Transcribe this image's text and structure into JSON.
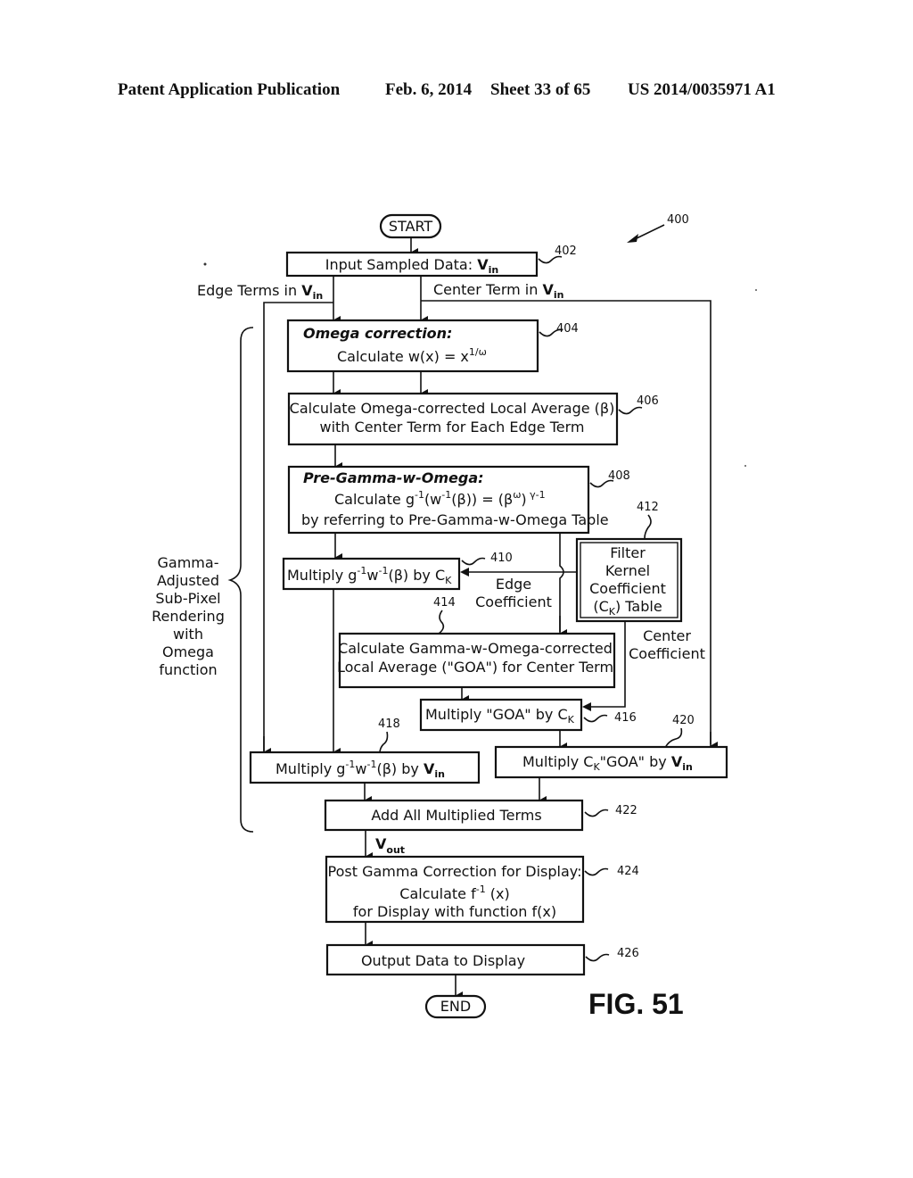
{
  "header": {
    "publication": "Patent Application Publication",
    "date": "Feb. 6, 2014",
    "sheet": "Sheet 33 of 65",
    "number": "US 2014/0035971 A1"
  },
  "figure": {
    "label": "FIG. 51",
    "ref": "400",
    "start": "START",
    "end": "END",
    "bracket_label": [
      "Gamma-",
      "Adjusted",
      "Sub-Pixel",
      "Rendering",
      "with",
      "Omega",
      "function"
    ],
    "edge_terms_label": "Edge Terms in ",
    "center_term_label": "Center Term in ",
    "vin_main": "V",
    "vin_sub": "in",
    "vout_main": "V",
    "vout_sub": "out",
    "edge_coefficient": [
      "Edge",
      "Coefficient"
    ],
    "center_coefficient": [
      "Center",
      "Coefficient"
    ],
    "steps": {
      "s402": {
        "ref": "402",
        "text": "Input Sampled Data: "
      },
      "s404": {
        "ref": "404",
        "title": "Omega correction:",
        "line": "Calculate w(x) = x",
        "sup": "1/ω"
      },
      "s406": {
        "ref": "406",
        "lines": [
          "Calculate Omega-corrected Local Average (β)",
          "with Center Term for Each Edge Term"
        ]
      },
      "s408": {
        "ref": "408",
        "title": "Pre-Gamma-w-Omega:",
        "line_a": "Calculate g",
        "sup1": "-1",
        "line_b": "(w",
        "sup2": "-1",
        "line_c": "(β)) = (β",
        "sup3": "ω",
        "line_d": ")",
        "sup4": " γ-1",
        "line2": "by referring to Pre-Gamma-w-Omega Table"
      },
      "s410": {
        "ref": "410",
        "a": "Multiply  g",
        "sup1": "-1",
        "b": "w",
        "sup2": "-1",
        "c": "(β) by C",
        "sub": "K"
      },
      "s412": {
        "ref": "412",
        "lines": [
          "Filter",
          "Kernel",
          "Coefficient"
        ],
        "last_a": "(C",
        "last_sub": "K",
        "last_b": ") Table"
      },
      "s414": {
        "ref": "414",
        "lines": [
          "Calculate Gamma-w-Omega-corrected",
          "Local Average (\"GOA\") for Center Term"
        ]
      },
      "s416": {
        "ref": "416",
        "a": "Multiply \"GOA\" by C",
        "sub": "K"
      },
      "s418": {
        "ref": "418",
        "a": "Multiply g",
        "sup1": "-1",
        "b": "w",
        "sup2": "-1",
        "c": "(β) by "
      },
      "s420": {
        "ref": "420",
        "a": "Multiply C",
        "sub": "K",
        "b": "\"GOA\" by "
      },
      "s422": {
        "ref": "422",
        "text": "Add All Multiplied Terms"
      },
      "s424": {
        "ref": "424",
        "line1": "Post Gamma Correction for Display:",
        "line2a": "Calculate f",
        "sup": "-1",
        "line2b": " (x)",
        "line3": "for Display with function f(x)"
      },
      "s426": {
        "ref": "426",
        "text": "Output Data to Display"
      }
    }
  }
}
